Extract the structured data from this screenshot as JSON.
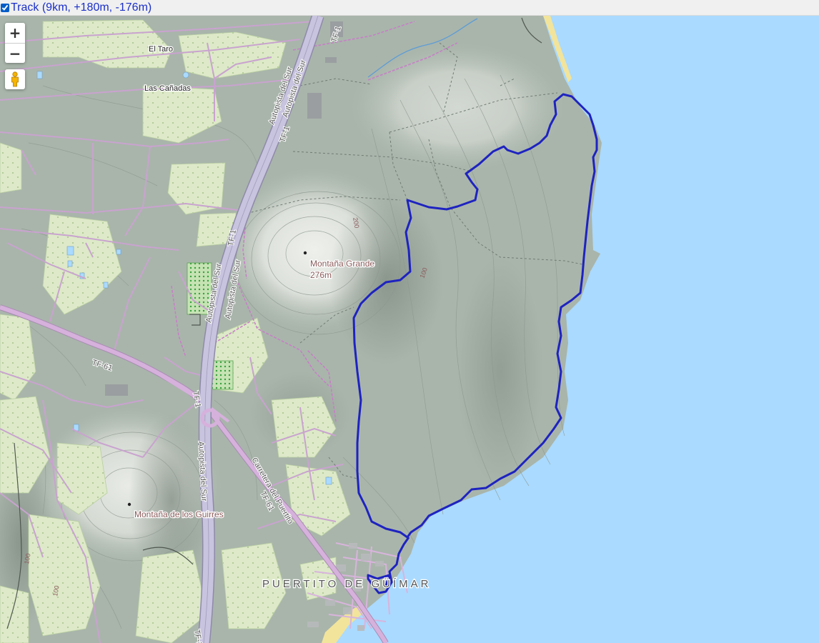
{
  "layer_bar": {
    "checkbox_checked": true,
    "title": "Track (9km, +180m, -176m)"
  },
  "controls": {
    "zoom_in": "+",
    "zoom_out": "−",
    "streetview_icon": "pegman-icon"
  },
  "labels": {
    "el_taro": "El Taro",
    "las_canadas": "Las Cañadas",
    "montana_grande": "Montaña Grande",
    "montana_grande_elev": "276m",
    "montana_guirres": "Montaña de los Guirres",
    "puertito": "PUERTITO DE GÜÍMAR",
    "road_tf1_a": "TF-1",
    "road_tf1_b": "TF-1",
    "road_tf1_c": "TF-1",
    "road_tf1_d": "TF-1",
    "road_tf1_e": "TF-1",
    "road_tf61_a": "TF-61",
    "road_tf61_b": "TF-61",
    "autopista_1": "Autopista del Sur",
    "autopista_2": "Autopista del Sur",
    "autopista_3": "Autopista del Sur",
    "autopista_4": "Autopista del Sur",
    "autopista_5": "Autopista del Sur",
    "carretera": "Carretera del Puertito",
    "contour_200": "200",
    "contour_100_a": "100",
    "contour_100_b": "100",
    "contour_100_c": "100"
  },
  "colors": {
    "sea": "#aadaff",
    "land": "#a9b5ab",
    "track": "#1e23c0",
    "road": "#c8a3ce",
    "motorway": "#c3bfdc",
    "farmland": "#dfeacb",
    "beach": "#f2e49a",
    "label_brown": "#8a5a5a"
  }
}
